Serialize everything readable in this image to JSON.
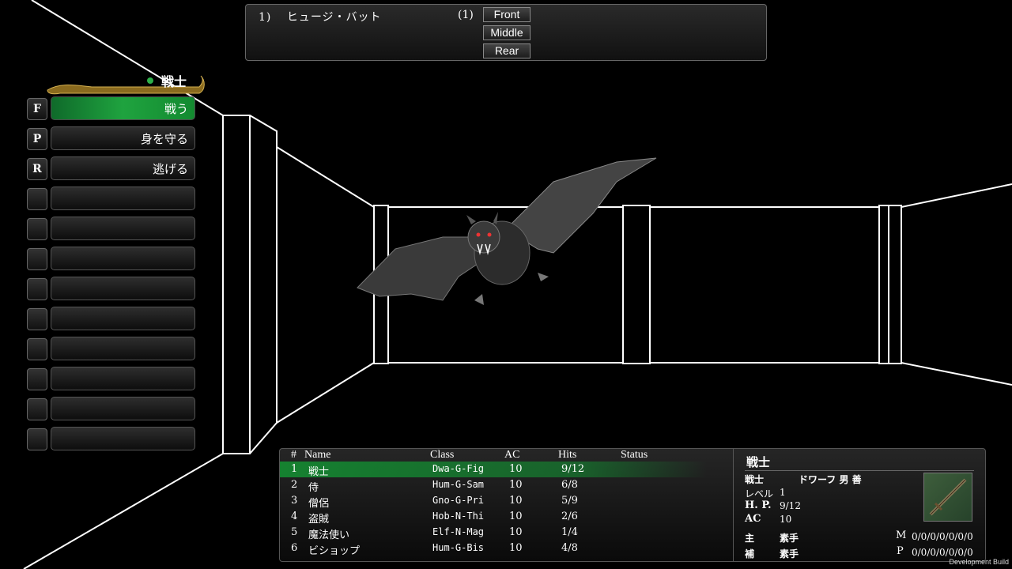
{
  "enemy_group": {
    "index": "1)",
    "name": "ヒュージ・バット",
    "count": "(1)",
    "positions": [
      "Front",
      "Middle",
      "Rear"
    ]
  },
  "character_banner": "戦士",
  "commands": [
    {
      "key": "F",
      "label": "戦う",
      "active": true
    },
    {
      "key": "P",
      "label": "身を守る",
      "active": false
    },
    {
      "key": "R",
      "label": "逃げる",
      "active": false
    },
    {
      "key": "",
      "label": "",
      "active": false
    },
    {
      "key": "",
      "label": "",
      "active": false
    },
    {
      "key": "",
      "label": "",
      "active": false
    },
    {
      "key": "",
      "label": "",
      "active": false
    },
    {
      "key": "",
      "label": "",
      "active": false
    },
    {
      "key": "",
      "label": "",
      "active": false
    },
    {
      "key": "",
      "label": "",
      "active": false
    },
    {
      "key": "",
      "label": "",
      "active": false
    },
    {
      "key": "",
      "label": "",
      "active": false
    }
  ],
  "party": {
    "headers": {
      "num": "#",
      "name": "Name",
      "class": "Class",
      "ac": "AC",
      "hits": "Hits",
      "status": "Status"
    },
    "rows": [
      {
        "num": "1",
        "name": "戦士",
        "class": "Dwa-G-Fig",
        "ac": "10",
        "hits": "9/12",
        "status": ""
      },
      {
        "num": "2",
        "name": "侍",
        "class": "Hum-G-Sam",
        "ac": "10",
        "hits": "6/8",
        "status": ""
      },
      {
        "num": "3",
        "name": "僧侶",
        "class": "Gno-G-Pri",
        "ac": "10",
        "hits": "5/9",
        "status": ""
      },
      {
        "num": "4",
        "name": "盗賊",
        "class": "Hob-N-Thi",
        "ac": "10",
        "hits": "2/6",
        "status": ""
      },
      {
        "num": "5",
        "name": "魔法使い",
        "class": "Elf-N-Mag",
        "ac": "10",
        "hits": "1/4",
        "status": ""
      },
      {
        "num": "6",
        "name": "ビショップ",
        "class": "Hum-G-Bis",
        "ac": "10",
        "hits": "4/8",
        "status": ""
      }
    ]
  },
  "detail": {
    "name": "戦士",
    "class": "戦士",
    "race_gender_align": "ドワーフ 男 善",
    "level_label": "レベル",
    "level": "1",
    "hp_label": "H. P.",
    "hp": "9/12",
    "ac_label": "AC",
    "ac": "10",
    "main_label": "主",
    "main_value": "素手",
    "sub_label": "補",
    "sub_value": "素手",
    "m_label": "M",
    "m_value": "0/0/0/0/0/0/0",
    "p_label": "P",
    "p_value": "0/0/0/0/0/0/0"
  },
  "footer": "Development Build",
  "colors": {
    "accent_green": "#1fa33f",
    "panel_border": "#666666"
  }
}
